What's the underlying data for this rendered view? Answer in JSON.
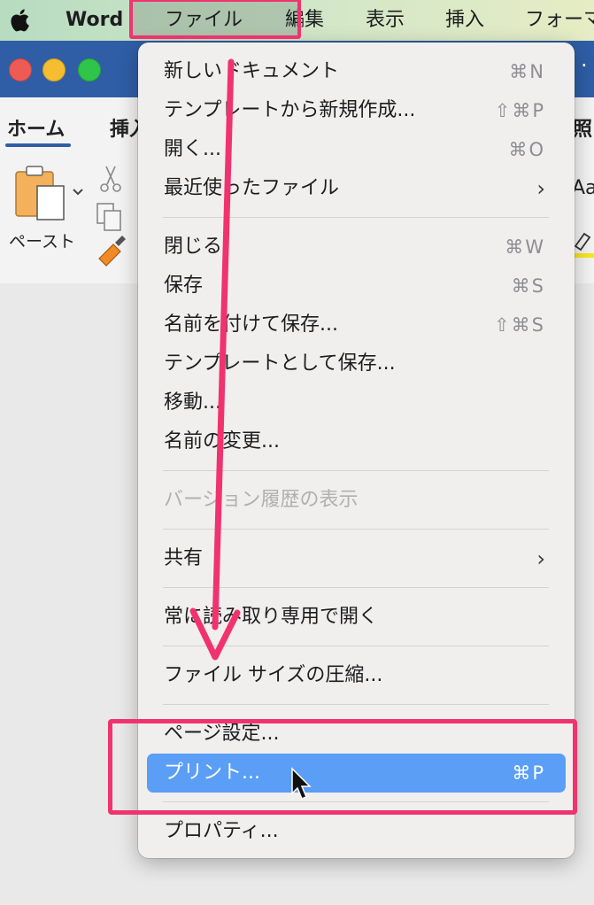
{
  "menubar": {
    "app": "Word",
    "items": [
      "ファイル",
      "編集",
      "表示",
      "挿入",
      "フォーマ"
    ]
  },
  "ribbon": {
    "tabs": [
      "ホーム",
      "挿入",
      "照"
    ],
    "paste_label": "ペースト",
    "styles_fragment": "Aa"
  },
  "file_menu": {
    "groups": [
      [
        {
          "label": "新しいドキュメント",
          "shortcut": "⌘N"
        },
        {
          "label": "テンプレートから新規作成...",
          "shortcut": "⇧⌘P"
        },
        {
          "label": "開く...",
          "shortcut": "⌘O"
        },
        {
          "label": "最近使ったファイル",
          "submenu": true
        }
      ],
      [
        {
          "label": "閉じる",
          "shortcut": "⌘W"
        },
        {
          "label": "保存",
          "shortcut": "⌘S"
        },
        {
          "label": "名前を付けて保存...",
          "shortcut": "⇧⌘S"
        },
        {
          "label": "テンプレートとして保存..."
        },
        {
          "label": "移動..."
        },
        {
          "label": "名前の変更..."
        }
      ],
      [
        {
          "label": "バージョン履歴の表示",
          "disabled": true
        }
      ],
      [
        {
          "label": "共有",
          "submenu": true
        }
      ],
      [
        {
          "label": "常に読み取り専用で開く"
        }
      ],
      [
        {
          "label": "ファイル サイズの圧縮..."
        }
      ],
      [
        {
          "label": "ページ設定..."
        },
        {
          "label": "プリント...",
          "shortcut": "⌘P",
          "selected": true
        }
      ],
      [
        {
          "label": "プロパティ..."
        }
      ]
    ],
    "selected_color": "#5a9ef6"
  },
  "annotation": {
    "highlight_color": "#f0336e"
  }
}
